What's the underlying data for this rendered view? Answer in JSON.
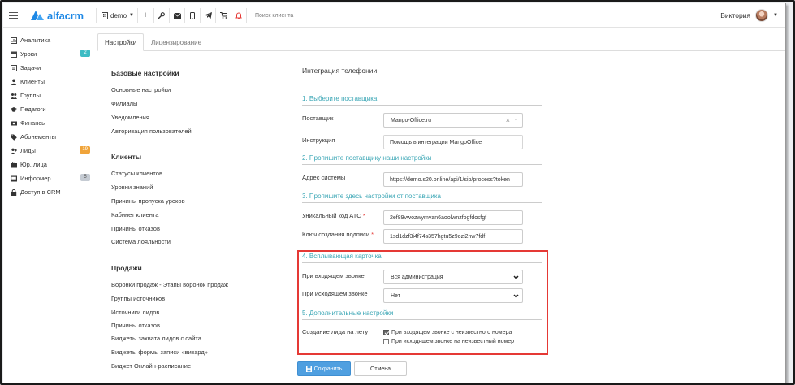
{
  "topbar": {
    "logo_text": "alfacrm",
    "branch_label": "demo",
    "search_placeholder": "Поиск клиента",
    "user_name": "Виктория"
  },
  "sidebar": {
    "items": [
      {
        "label": "Аналитика",
        "icon": "analytics-icon"
      },
      {
        "label": "Уроки",
        "icon": "calendar-icon",
        "badge": "2",
        "badge_color": "#3dbcc4"
      },
      {
        "label": "Задачи",
        "icon": "tasks-icon"
      },
      {
        "label": "Клиенты",
        "icon": "user-icon"
      },
      {
        "label": "Группы",
        "icon": "users-icon"
      },
      {
        "label": "Педагоги",
        "icon": "graduation-cap-icon"
      },
      {
        "label": "Финансы",
        "icon": "money-icon"
      },
      {
        "label": "Абонементы",
        "icon": "tag-icon"
      },
      {
        "label": "Лиды",
        "icon": "user-plus-icon",
        "badge": "19",
        "badge_color": "#f0a43a"
      },
      {
        "label": "Юр. лица",
        "icon": "briefcase-icon"
      },
      {
        "label": "Информер",
        "icon": "inbox-icon",
        "badge": "5",
        "badge_color": "#c5cbd3"
      },
      {
        "label": "Доступ в CRM",
        "icon": "lock-icon"
      }
    ]
  },
  "tabs": [
    "Настройки",
    "Лицензирование"
  ],
  "menu": {
    "groups": [
      {
        "title": "Базовые настройки",
        "items": [
          "Основные настройки",
          "Филиалы",
          "Уведомления",
          "Авторизация пользователей"
        ]
      },
      {
        "title": "Клиенты",
        "items": [
          "Статусы клиентов",
          "Уровни знаний",
          "Причины пропуска уроков",
          "Кабинет клиента",
          "Причины отказов",
          "Система лояльности"
        ]
      },
      {
        "title": "Продажи",
        "items": [
          "Воронки продаж - Этапы воронок продаж",
          "Группы источников",
          "Источники лидов",
          "Причины отказов",
          "Виджеты захвата лидов с сайта",
          "Виджеты формы записи «визард»",
          "Виджет Онлайн-расписание"
        ]
      }
    ]
  },
  "form": {
    "title": "Интеграция телефонии",
    "section1": "1. Выберите поставщика",
    "provider_label": "Поставщик",
    "provider_value": "Mango-Office.ru",
    "instruction_label": "Инструкция",
    "instruction_value": "Помощь в интеграции MangoOffice",
    "section2": "2. Пропишите поставщику наши настройки",
    "system_address_label": "Адрес системы",
    "system_address_value": "https://demo.s20.online/api/1/sip/process?token",
    "section3": "3. Пропишите здесь настройки от поставщика",
    "ats_code_label": "Уникальный код АТС",
    "ats_code_value": "2ef89vwozwymvan6aoolwnzfogfdcsfgf",
    "sign_key_label": "Ключ создания подписи",
    "sign_key_value": "1sd1dzf3i4f74s357hgtu5z9ozi2nw7fdf",
    "section4": "4. Всплывающая карточка",
    "incoming_label": "При входящем звонке",
    "incoming_value": "Вся администрация",
    "outgoing_label": "При исходящем звонке",
    "outgoing_value": "Нет",
    "section5": "5. Дополнительные настройки",
    "lead_label": "Создание лида на лету",
    "check_incoming": "При входящем звонке с неизвестного номера",
    "check_incoming_checked": true,
    "check_outgoing": "При исходящем звонке на неизвестный номер",
    "check_outgoing_checked": false,
    "save_label": "Сохранить",
    "cancel_label": "Отмена"
  },
  "colors": {
    "accent": "#1e88e5",
    "section_title": "#3aa6b5",
    "save_button": "#4f9fe0",
    "highlight_box": "#e53935"
  }
}
